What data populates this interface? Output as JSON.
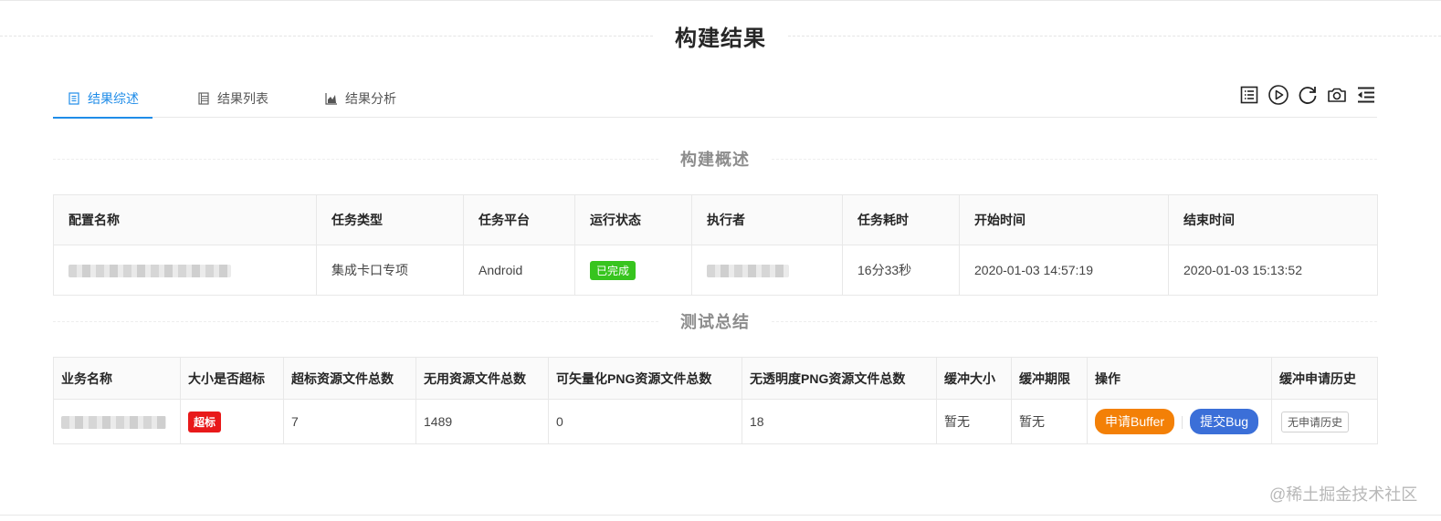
{
  "title": "构建结果",
  "tabs": [
    {
      "label": "结果综述",
      "icon": "document-icon",
      "active": true
    },
    {
      "label": "结果列表",
      "icon": "list-icon",
      "active": false
    },
    {
      "label": "结果分析",
      "icon": "area-chart-icon",
      "active": false
    }
  ],
  "toolbar": [
    "log-icon",
    "play-icon",
    "refresh-icon",
    "camera-icon",
    "collapse-menu-icon"
  ],
  "overview": {
    "title": "构建概述",
    "headers": [
      "配置名称",
      "任务类型",
      "任务平台",
      "运行状态",
      "执行者",
      "任务耗时",
      "开始时间",
      "结束时间"
    ],
    "row": {
      "task_type": "集成卡口专项",
      "platform": "Android",
      "status": "已完成",
      "duration": "16分33秒",
      "start_time": "2020-01-03 14:57:19",
      "end_time": "2020-01-03 15:13:52"
    }
  },
  "summary": {
    "title": "测试总结",
    "headers": [
      "业务名称",
      "大小是否超标",
      "超标资源文件总数",
      "无用资源文件总数",
      "可矢量化PNG资源文件总数",
      "无透明度PNG资源文件总数",
      "缓冲大小",
      "缓冲期限",
      "操作",
      "缓冲申请历史"
    ],
    "row": {
      "over_limit": "超标",
      "over_count": "7",
      "unused_count": "1489",
      "vectorizable_count": "0",
      "no_alpha_count": "18",
      "buffer_size": "暂无",
      "buffer_period": "暂无",
      "apply_buffer": "申请Buffer",
      "submit_bug": "提交Bug",
      "history": "无申请历史"
    }
  },
  "watermark": "@稀土掘金技术社区",
  "colors": {
    "accent": "#1f8ce8",
    "success": "#37c41e",
    "danger": "#e8191a",
    "orange": "#f38007",
    "blue": "#3b6fd8"
  }
}
